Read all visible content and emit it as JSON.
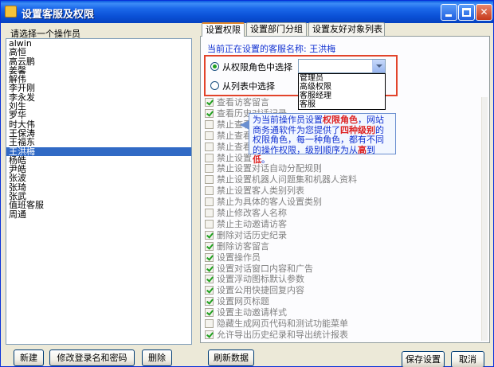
{
  "window": {
    "title": "设置客服及权限"
  },
  "operators": {
    "label": "请选择一个操作员",
    "items": [
      "alwin",
      "高恒",
      "高云鹏",
      "姜馨",
      "解伟",
      "李开刚",
      "李永发",
      "刘生",
      "罗华",
      "时大伟",
      "王保涛",
      "王福东",
      "王洪梅",
      "杨皓",
      "尹皓",
      "张波",
      "张琦",
      "张武",
      "值班客服",
      "周通"
    ],
    "selected_index": 12
  },
  "tabs": [
    {
      "label": "设置权限",
      "active": true
    },
    {
      "label": "设置部门分组",
      "active": false
    },
    {
      "label": "设置友好对象列表",
      "active": false
    }
  ],
  "permissions_panel": {
    "current_operator": "当前正在设置的客服名称: 王洪梅",
    "role_radio_label": "从权限角色中选择",
    "list_radio_label": "从列表中选择",
    "role_select_value": "",
    "role_options": [
      "管理员",
      "高级权限",
      "客服经理",
      "客服"
    ],
    "items": [
      {
        "label": "查看访客留言",
        "checked": true
      },
      {
        "label": "查看历史对话记录",
        "checked": true
      },
      {
        "label": "禁止查看",
        "checked": false
      },
      {
        "label": "禁止查看",
        "checked": false
      },
      {
        "label": "禁止查看",
        "checked": false
      },
      {
        "label": "禁止设置",
        "checked": false
      },
      {
        "label": "禁止设置对话自动分配规则",
        "checked": false
      },
      {
        "label": "禁止设置机器人问题集和机器人资料",
        "checked": false
      },
      {
        "label": "禁止设置客人类别列表",
        "checked": false
      },
      {
        "label": "禁止为具体的客人设置类别",
        "checked": false
      },
      {
        "label": "禁止修改客人名称",
        "checked": false
      },
      {
        "label": "禁止主动邀请访客",
        "checked": false
      },
      {
        "label": "删除对话历史纪录",
        "checked": true
      },
      {
        "label": "删除访客留言",
        "checked": true
      },
      {
        "label": "设置操作员",
        "checked": true
      },
      {
        "label": "设置对话窗口内容和广告",
        "checked": true
      },
      {
        "label": "设置浮动图标默认参数",
        "checked": true
      },
      {
        "label": "设置公用快捷回复内容",
        "checked": true
      },
      {
        "label": "设置网页标题",
        "checked": true
      },
      {
        "label": "设置主动邀请样式",
        "checked": true
      },
      {
        "label": "隐藏生成网页代码和测试功能菜单",
        "checked": false
      },
      {
        "label": "允许导出历史纪录和导出统计报表",
        "checked": true
      }
    ]
  },
  "callout": {
    "parts": [
      "为当前操作员设置",
      "权限角色",
      "，网站商务通软件为您提供了",
      "四种级别",
      "的权限角色，每一种角色，都有不同的操作权限，级别顺序为从",
      "高",
      "到",
      "低",
      "。"
    ]
  },
  "buttons": {
    "new": "新建",
    "modify": "修改登录名和密码",
    "delete": "删除",
    "refresh": "刷新数据",
    "save": "保存设置",
    "cancel": "取消"
  }
}
